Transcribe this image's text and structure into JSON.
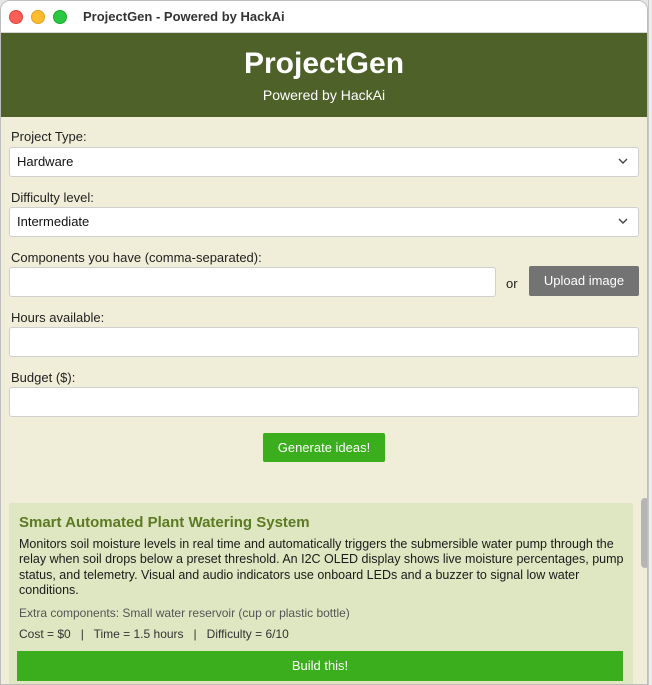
{
  "window": {
    "title": "ProjectGen - Powered by HackAi"
  },
  "header": {
    "app_name": "ProjectGen",
    "subtitle": "Powered by HackAi"
  },
  "form": {
    "project_type": {
      "label": "Project Type:",
      "value": "Hardware"
    },
    "difficulty": {
      "label": "Difficulty level:",
      "value": "Intermediate"
    },
    "components": {
      "label": "Components you have (comma-separated):",
      "value": "",
      "or_text": "or",
      "upload_label": "Upload image"
    },
    "hours": {
      "label": "Hours available:",
      "value": ""
    },
    "budget": {
      "label": "Budget ($):",
      "value": ""
    },
    "generate_label": "Generate ideas!"
  },
  "results": [
    {
      "title": "Smart Automated Plant Watering System",
      "description": "Monitors soil moisture levels in real time and automatically triggers the submersible water pump through the relay when soil drops below a preset threshold. An I2C OLED display shows live moisture percentages, pump status, and telemetry. Visual and audio indicators use onboard LEDs and a buzzer to signal low water conditions.",
      "extra_components": "Extra components: Small water reservoir (cup or plastic bottle)",
      "meta": "Cost = $0   |   Time = 1.5 hours   |   Difficulty = 6/10",
      "build_label": "Build this!"
    }
  ],
  "colors": {
    "header_bg": "#4e6128",
    "page_bg": "#f0eed8",
    "accent_green": "#3aae1c",
    "card_bg": "#dee7c2",
    "card_title": "#5c7a22"
  },
  "icons": {
    "dropdown": "chevron-down-icon"
  }
}
